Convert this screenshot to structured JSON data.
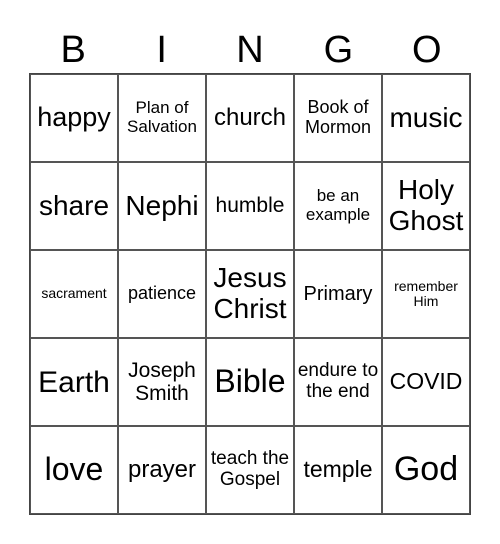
{
  "header": [
    "B",
    "I",
    "N",
    "G",
    "O"
  ],
  "cells": [
    {
      "text": "happy",
      "size": 27
    },
    {
      "text": "Plan of Salvation",
      "size": 17
    },
    {
      "text": "church",
      "size": 24
    },
    {
      "text": "Book of Mormon",
      "size": 18
    },
    {
      "text": "music",
      "size": 28
    },
    {
      "text": "share",
      "size": 28
    },
    {
      "text": "Nephi",
      "size": 28
    },
    {
      "text": "humble",
      "size": 21
    },
    {
      "text": "be an example",
      "size": 17
    },
    {
      "text": "Holy Ghost",
      "size": 28
    },
    {
      "text": "sacrament",
      "size": 14
    },
    {
      "text": "patience",
      "size": 18
    },
    {
      "text": "Jesus Christ",
      "size": 28
    },
    {
      "text": "Primary",
      "size": 20
    },
    {
      "text": "remember Him",
      "size": 14
    },
    {
      "text": "Earth",
      "size": 30
    },
    {
      "text": "Joseph Smith",
      "size": 21
    },
    {
      "text": "Bible",
      "size": 32
    },
    {
      "text": "endure to the end",
      "size": 19
    },
    {
      "text": "COVID",
      "size": 23
    },
    {
      "text": "love",
      "size": 32
    },
    {
      "text": "prayer",
      "size": 24
    },
    {
      "text": "teach the Gospel",
      "size": 19
    },
    {
      "text": "temple",
      "size": 23
    },
    {
      "text": "God",
      "size": 34
    }
  ]
}
